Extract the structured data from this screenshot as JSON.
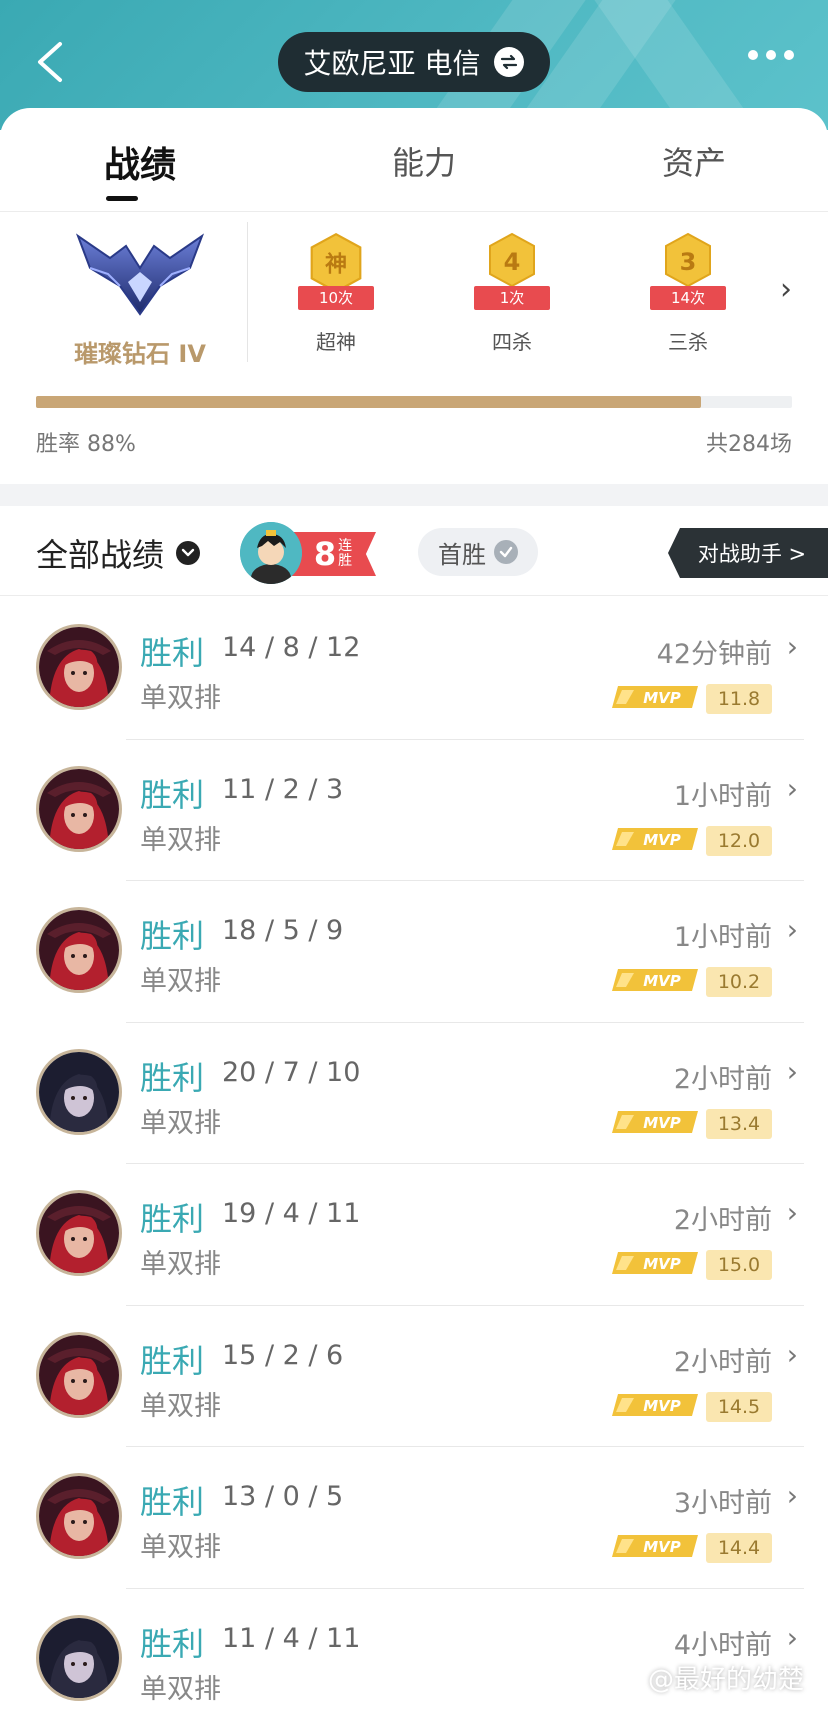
{
  "header": {
    "server": "艾欧尼亚 电信"
  },
  "tabs": [
    {
      "label": "战绩"
    },
    {
      "label": "能力"
    },
    {
      "label": "资产"
    }
  ],
  "rank": {
    "name": "璀璨钻石 IV"
  },
  "achievements": [
    {
      "glyph": "神",
      "count": "10次",
      "label": "超神"
    },
    {
      "glyph": "4",
      "count": "1次",
      "label": "四杀"
    },
    {
      "glyph": "3",
      "count": "14次",
      "label": "三杀"
    }
  ],
  "stats": {
    "win_rate_label": "胜率 88%",
    "win_rate": 0.88,
    "total_label": "共284场"
  },
  "filter": {
    "title": "全部战绩",
    "streak_num": "8",
    "streak_text": "连胜",
    "first_win": "首胜",
    "assistant": "对战助手 >"
  },
  "matches": [
    {
      "result": "胜利",
      "kda": "14 / 8 / 12",
      "mode": "单双排",
      "time": "42分钟前",
      "mvp": "MVP",
      "score": "11.8",
      "hero": "red"
    },
    {
      "result": "胜利",
      "kda": "11 / 2 / 3",
      "mode": "单双排",
      "time": "1小时前",
      "mvp": "MVP",
      "score": "12.0",
      "hero": "red"
    },
    {
      "result": "胜利",
      "kda": "18 / 5 / 9",
      "mode": "单双排",
      "time": "1小时前",
      "mvp": "MVP",
      "score": "10.2",
      "hero": "red"
    },
    {
      "result": "胜利",
      "kda": "20 / 7 / 10",
      "mode": "单双排",
      "time": "2小时前",
      "mvp": "MVP",
      "score": "13.4",
      "hero": "dark"
    },
    {
      "result": "胜利",
      "kda": "19 / 4 / 11",
      "mode": "单双排",
      "time": "2小时前",
      "mvp": "MVP",
      "score": "15.0",
      "hero": "red"
    },
    {
      "result": "胜利",
      "kda": "15 / 2 / 6",
      "mode": "单双排",
      "time": "2小时前",
      "mvp": "MVP",
      "score": "14.5",
      "hero": "red"
    },
    {
      "result": "胜利",
      "kda": "13 / 0 / 5",
      "mode": "单双排",
      "time": "3小时前",
      "mvp": "MVP",
      "score": "14.4",
      "hero": "red"
    },
    {
      "result": "胜利",
      "kda": "11 / 4 / 11",
      "mode": "单双排",
      "time": "4小时前",
      "mvp": "",
      "score": "",
      "hero": "dark"
    }
  ],
  "watermark": "@最好的幼楚"
}
